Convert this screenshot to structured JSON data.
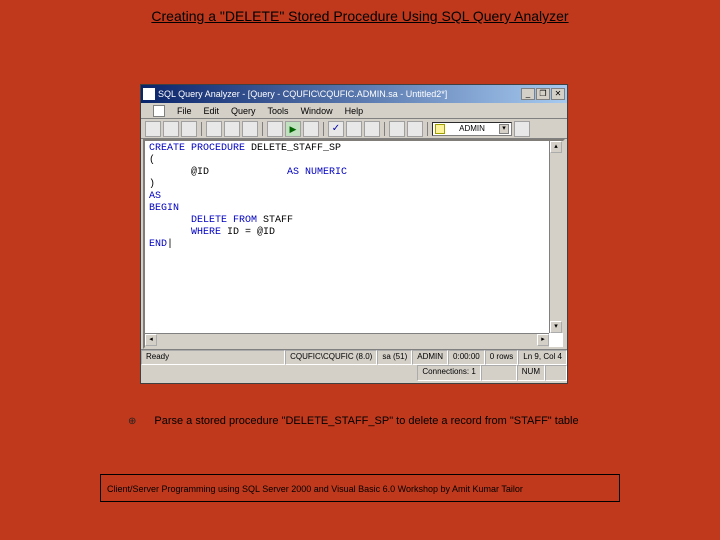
{
  "slide": {
    "title": "Creating a \"DELETE\" Stored Procedure Using SQL Query Analyzer",
    "bullet": "Parse a stored procedure \"DELETE_STAFF_SP\" to delete a record from \"STAFF\" table",
    "footer": "Client/Server Programming using SQL Server 2000 and Visual Basic 6.0 Workshop by Amit Kumar Tailor"
  },
  "window": {
    "title": "SQL Query Analyzer - [Query - CQUFIC\\CQUFIC.ADMIN.sa - Untitled2*]",
    "min": "_",
    "max": "❐",
    "close": "✕"
  },
  "menu": {
    "file": "File",
    "edit": "Edit",
    "query": "Query",
    "tools": "Tools",
    "window": "Window",
    "help": "Help"
  },
  "db_combo": "ADMIN",
  "code": {
    "l1a": "CREATE PROCEDURE",
    "l1b": " DELETE_STAFF_SP",
    "l2": "(",
    "l3a": "       @ID             ",
    "l3b": "AS NUMERIC",
    "l4": ")",
    "l5": "AS",
    "l6": "BEGIN",
    "l7a": "       ",
    "l7b": "DELETE FROM",
    "l7c": " STAFF",
    "l8a": "       ",
    "l8b": "WHERE",
    "l8c": " ID = @ID",
    "l9": "END"
  },
  "status": {
    "ready": "Ready",
    "server": "CQUFIC\\CQUFIC (8.0)",
    "user": "sa (51)",
    "db": "ADMIN",
    "time": "0:00:00",
    "rows": "0 rows",
    "pos": "Ln 9, Col 4",
    "conn": "Connections: 1",
    "num": "NUM"
  }
}
